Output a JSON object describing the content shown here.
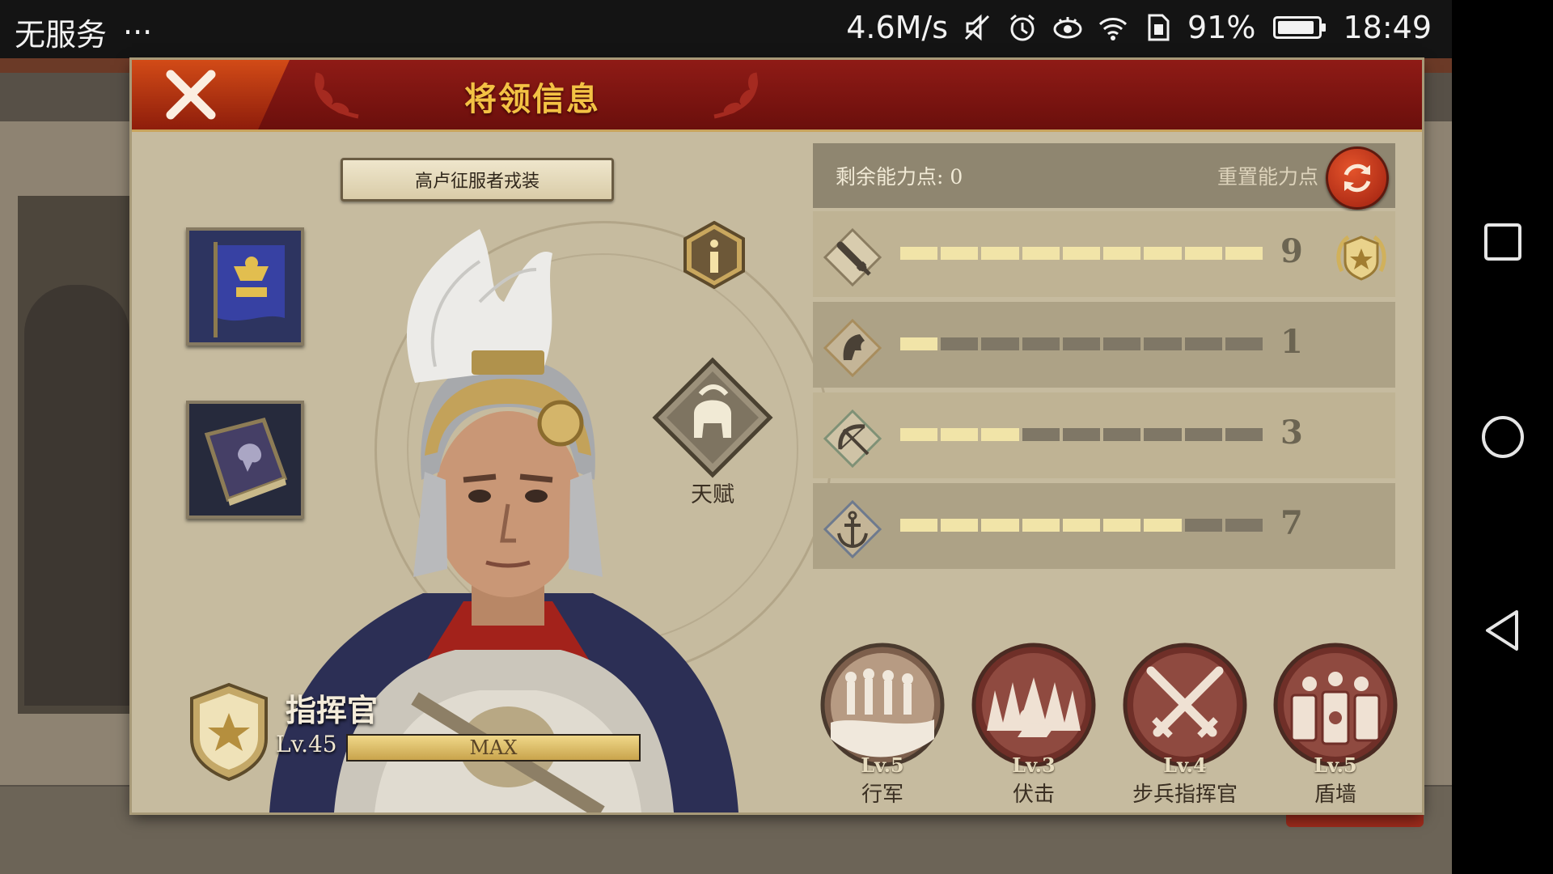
{
  "status_bar": {
    "carrier": "无服务",
    "more": "···",
    "net_speed": "4.6M/s",
    "battery_pct": "91%",
    "battery_level": 0.91,
    "time": "18:49",
    "icons": [
      "mute-icon",
      "alarm-icon",
      "eye-icon",
      "wifi-icon",
      "sim-icon",
      "battery-icon"
    ]
  },
  "nav_bar": {
    "icons": [
      "recents-icon",
      "home-icon",
      "back-icon"
    ]
  },
  "header": {
    "title": "将领信息",
    "close_icon": "close-x-icon",
    "accent": "#f3c244",
    "bg": "#7a1411"
  },
  "hero": {
    "outfit_name": "高卢征服者戎装",
    "rank_title": "指挥官",
    "level": "Lv.45",
    "level_bar_text": "MAX",
    "level_progress": 1.0,
    "items": [
      {
        "icon": "legion-banner-icon"
      },
      {
        "icon": "book-icon"
      }
    ],
    "info_icon": "info-icon",
    "talent_label": "天赋",
    "talent_icon": "helmet-icon"
  },
  "stats": {
    "remaining_points_label": "剩余能力点: 0",
    "reset_label": "重置能力点",
    "reset_icon": "refresh-icon",
    "max_points": 9,
    "rows": [
      {
        "icon": "sword-icon",
        "value": 9,
        "value_text": "9",
        "badge": "laurel-star-icon"
      },
      {
        "icon": "horse-icon",
        "value": 1,
        "value_text": "1"
      },
      {
        "icon": "bow-icon",
        "value": 3,
        "value_text": "3"
      },
      {
        "icon": "anchor-icon",
        "value": 7,
        "value_text": "7"
      }
    ]
  },
  "skills": [
    {
      "level": "Lv.5",
      "name": "行军",
      "icon": "march-icon"
    },
    {
      "level": "Lv.3",
      "name": "伏击",
      "icon": "ambush-icon"
    },
    {
      "level": "Lv.4",
      "name": "步兵指挥官",
      "icon": "crossed-swords-icon"
    },
    {
      "level": "Lv.5",
      "name": "盾墙",
      "icon": "shield-wall-icon"
    }
  ]
}
